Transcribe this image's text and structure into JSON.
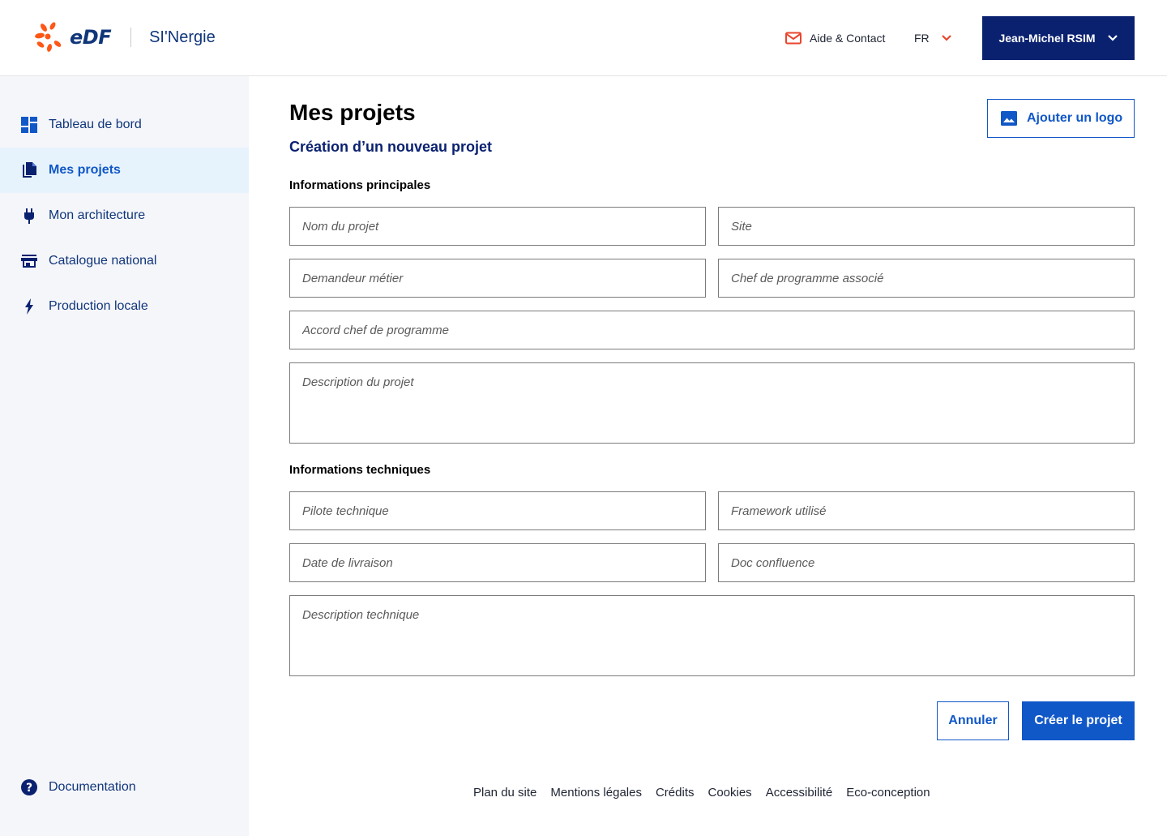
{
  "header": {
    "brand_logo_text": "eDF",
    "app_name": "SI'Nergie",
    "help_label": "Aide & Contact",
    "language": "FR",
    "user_name": "Jean-Michel RSIM"
  },
  "sidebar": {
    "items": [
      {
        "label": "Tableau de bord",
        "icon": "dashboard-icon"
      },
      {
        "label": "Mes projets",
        "icon": "documents-icon",
        "active": true
      },
      {
        "label": "Mon architecture",
        "icon": "plug-icon"
      },
      {
        "label": "Catalogue national",
        "icon": "store-icon"
      },
      {
        "label": "Production locale",
        "icon": "lightning-icon"
      }
    ],
    "documentation": {
      "label": "Documentation",
      "icon": "help-icon"
    }
  },
  "main": {
    "title": "Mes projets",
    "subtitle": "Création d’un nouveau projet",
    "logo_button": "Ajouter un logo",
    "section_main": "Informations principales",
    "section_tech": "Informations techniques",
    "fields": {
      "project_name": {
        "placeholder": "Nom du projet",
        "value": ""
      },
      "site": {
        "placeholder": "Site",
        "value": ""
      },
      "requester": {
        "placeholder": "Demandeur métier",
        "value": ""
      },
      "program_chief": {
        "placeholder": "Chef de programme associé",
        "value": ""
      },
      "program_agreement": {
        "placeholder": "Accord chef de programme",
        "value": ""
      },
      "project_description": {
        "placeholder": "Description du projet",
        "value": ""
      },
      "tech_pilot": {
        "placeholder": "Pilote technique",
        "value": ""
      },
      "framework": {
        "placeholder": "Framework utilisé",
        "value": ""
      },
      "delivery_date": {
        "placeholder": "Date de livraison",
        "value": ""
      },
      "confluence_doc": {
        "placeholder": "Doc confluence",
        "value": ""
      },
      "tech_description": {
        "placeholder": "Description technique",
        "value": ""
      }
    },
    "cancel_label": "Annuler",
    "create_label": "Créer le projet"
  },
  "footer": {
    "links": [
      "Plan du site",
      "Mentions légales",
      "Crédits",
      "Cookies",
      "Accessibilité",
      "Eco-conception"
    ]
  },
  "colors": {
    "primary": "#1057c8",
    "navy": "#0a2170",
    "edf_orange": "#fe5716",
    "sidebar_bg": "#f5f6fa",
    "active_bg": "#e7f3fc"
  }
}
